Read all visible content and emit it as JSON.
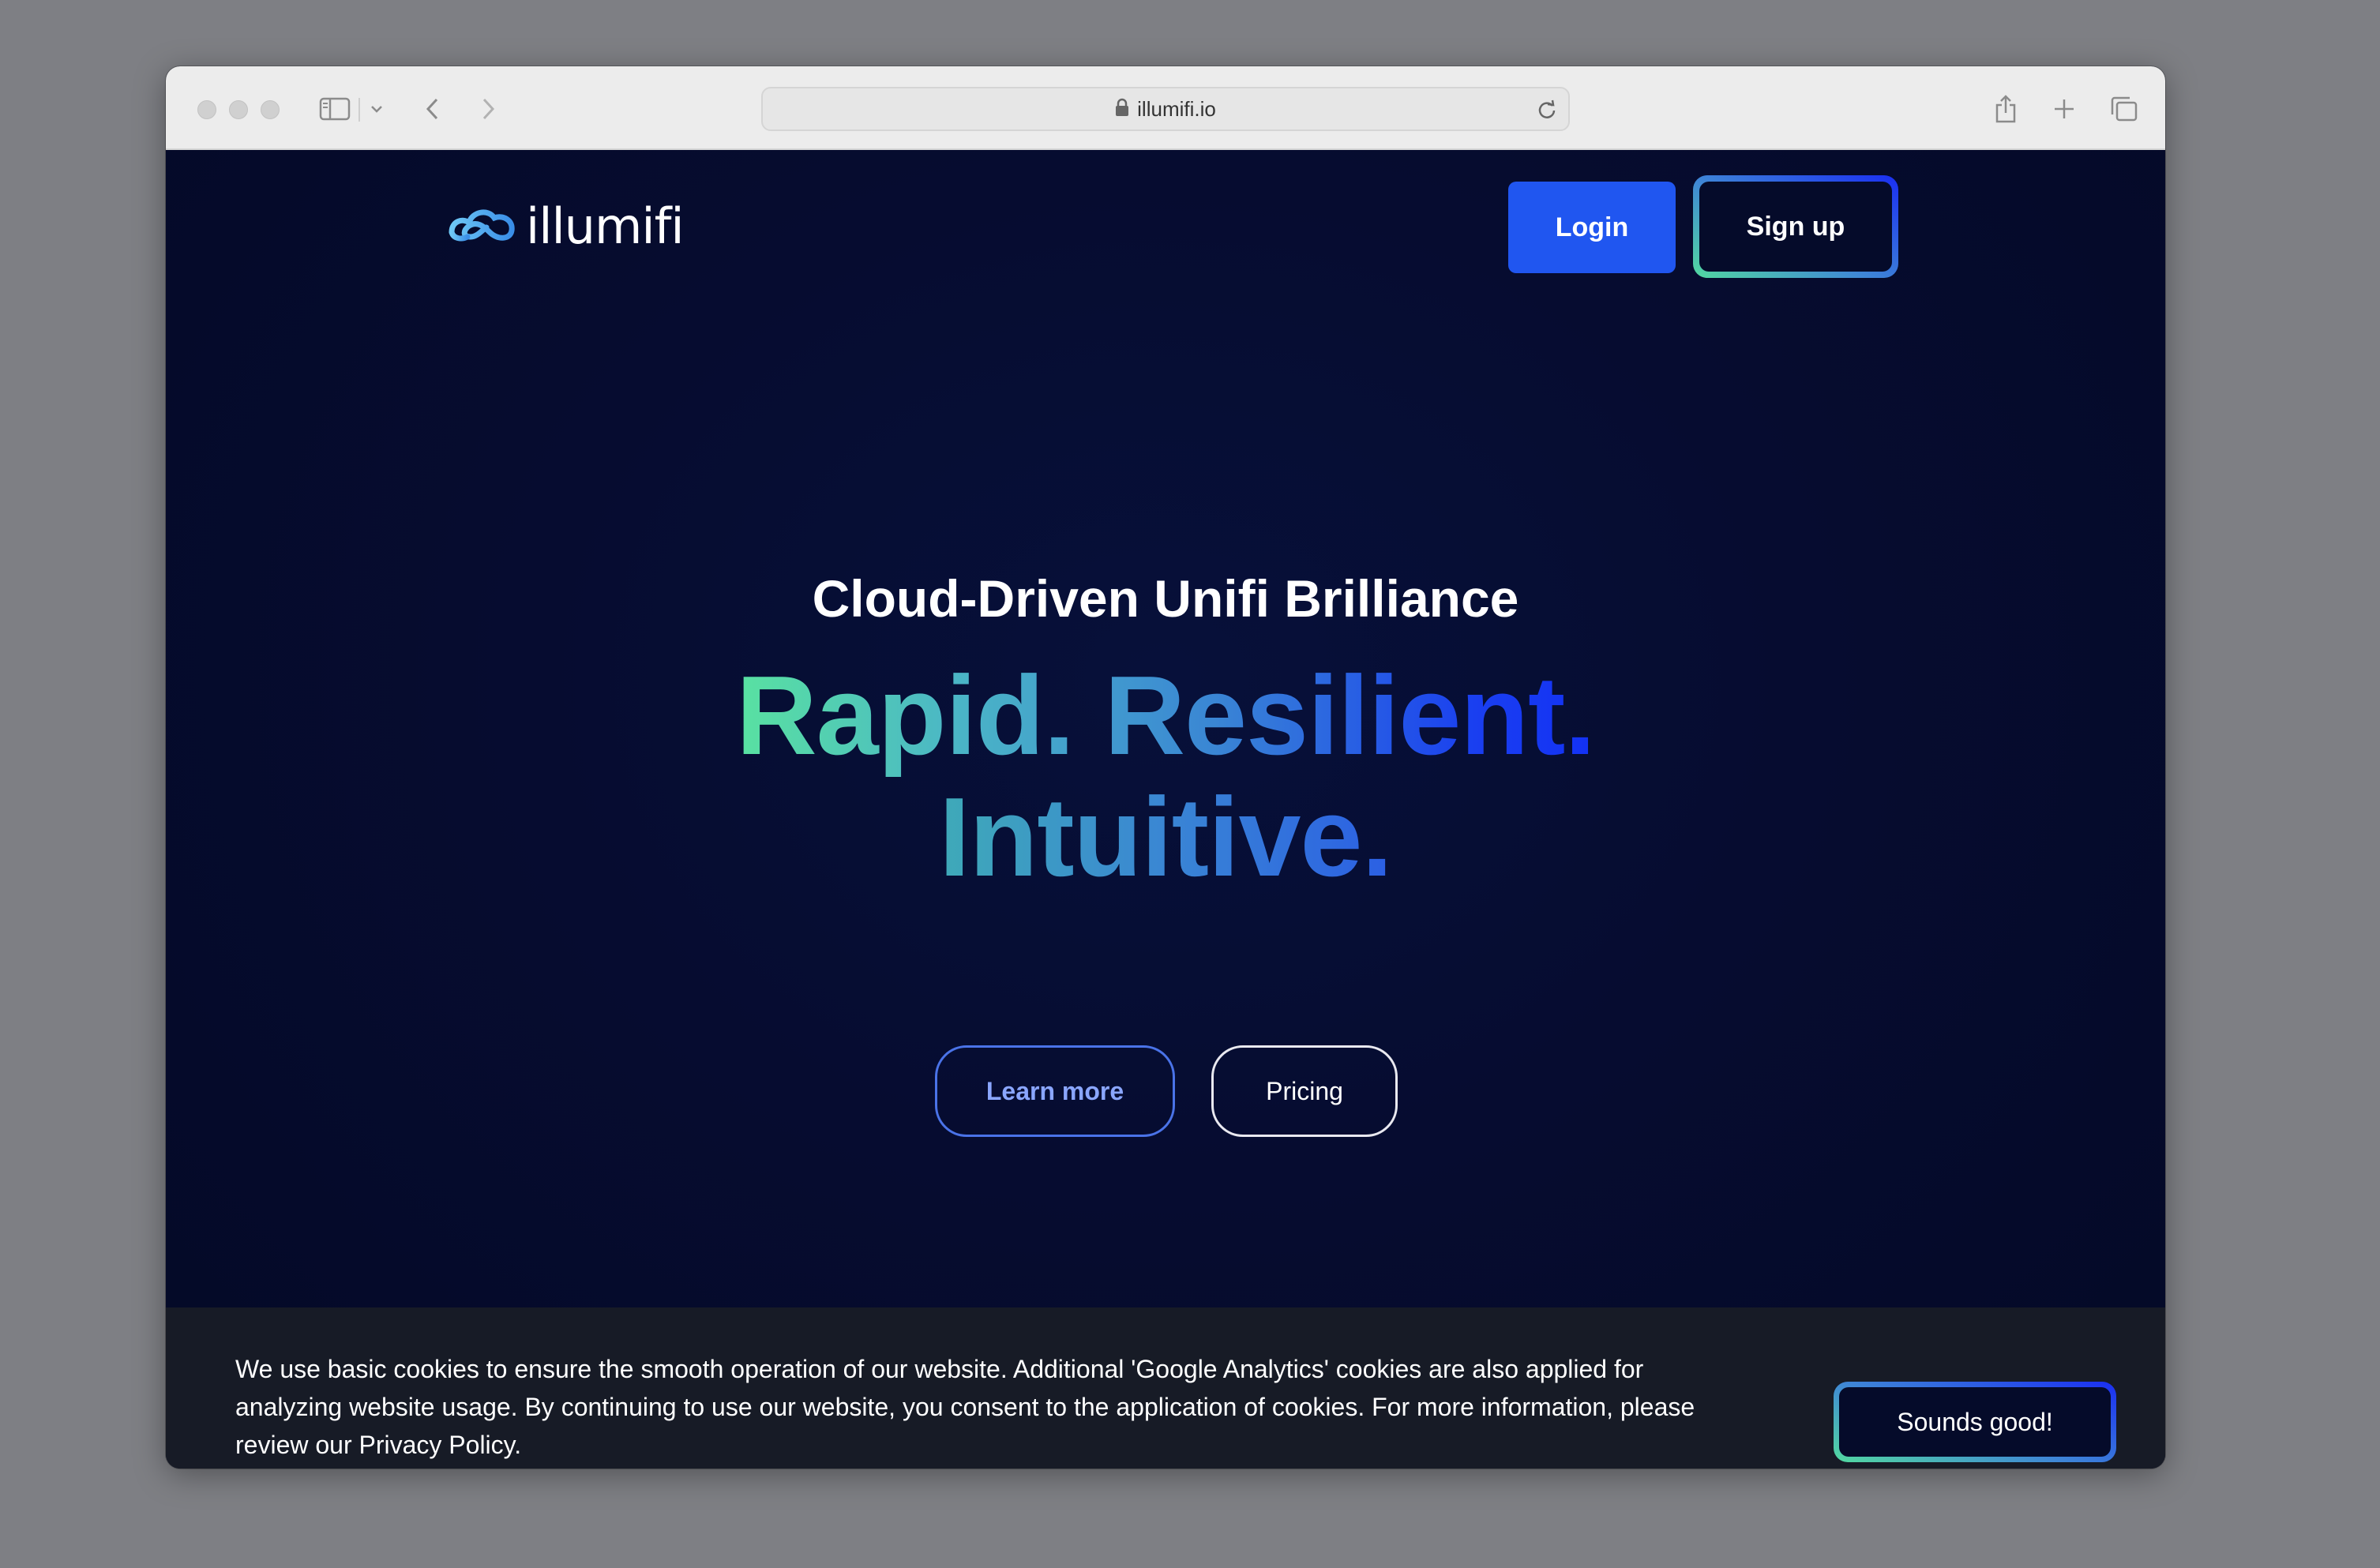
{
  "browser": {
    "url": "illumifi.io",
    "icons": {
      "lock": "lock-icon",
      "reload": "reload-icon",
      "sidebar": "sidebar-icon",
      "back": "chevron-left-icon",
      "forward": "chevron-right-icon",
      "share": "share-icon",
      "new_tab": "plus-icon",
      "tabs": "tab-overview-icon"
    }
  },
  "header": {
    "logo_text": "illumifi",
    "login_label": "Login",
    "signup_label": "Sign up"
  },
  "hero": {
    "subheading": "Cloud-Driven Unifi Brilliance",
    "headline_line1": "Rapid. Resilient.",
    "headline_line2": "Intuitive.",
    "learn_more_label": "Learn more",
    "pricing_label": "Pricing"
  },
  "cookie_banner": {
    "message": "We use basic cookies to ensure the smooth operation of our website. Additional 'Google Analytics' cookies are also applied for analyzing website usage. By continuing to use our website, you consent to the application of cookies. For more information, please review our Privacy Policy.",
    "accept_label": "Sounds good!"
  },
  "colors": {
    "page_background": "#050b2a",
    "login_button": "#2056f0",
    "gradient_start": "#59e2a1",
    "gradient_end": "#1230f5",
    "cookie_background": "#171b26"
  }
}
